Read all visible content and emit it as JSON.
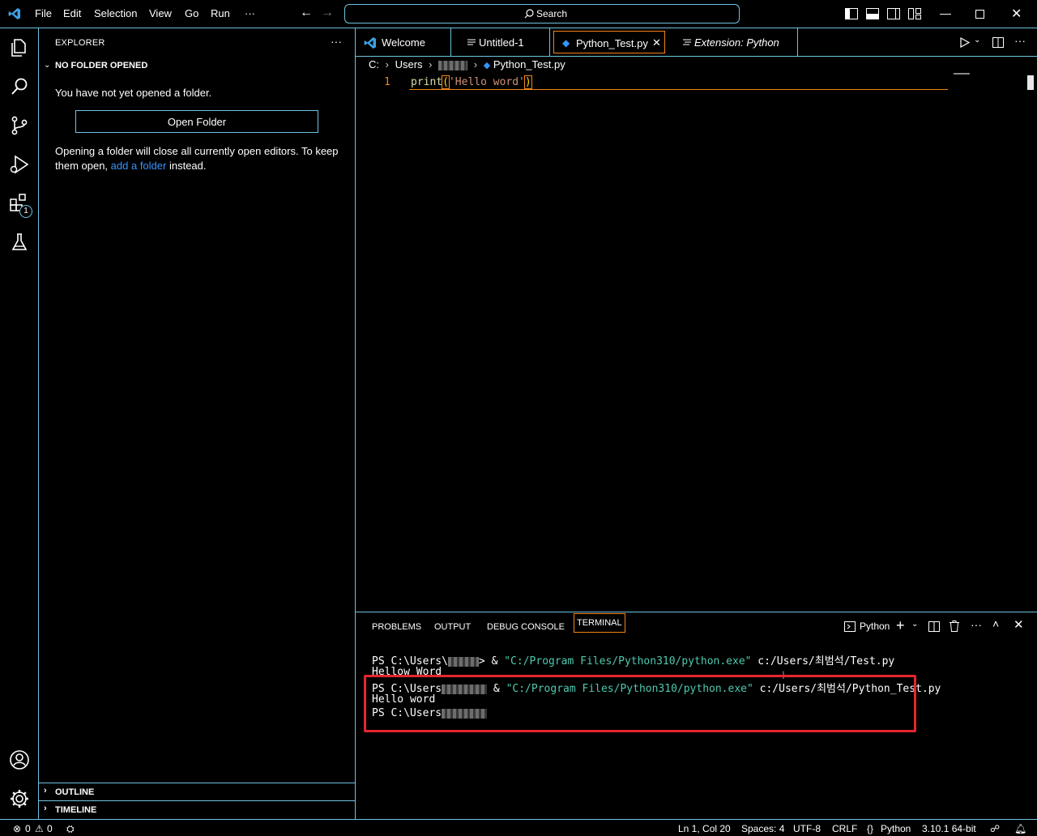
{
  "titlebar": {
    "menus": [
      "File",
      "Edit",
      "Selection",
      "View",
      "Go",
      "Run",
      "···"
    ],
    "search_label": "Search"
  },
  "sidebar": {
    "title": "EXPLORER",
    "section_title": "NO FOLDER OPENED",
    "message": "You have not yet opened a folder.",
    "open_folder_label": "Open Folder",
    "hint_prefix": "Opening a folder will close all currently open editors. To keep them open,",
    "hint_link": "add a folder",
    "hint_suffix": "instead.",
    "outline_label": "OUTLINE",
    "timeline_label": "TIMELINE",
    "extensions_badge": "1"
  },
  "tabs": [
    {
      "label": "Welcome"
    },
    {
      "label": "Untitled-1"
    },
    {
      "label": "Python_Test.py"
    },
    {
      "label": "Extension: Python"
    }
  ],
  "breadcrumb": {
    "drive": "C:",
    "folder": "Users",
    "file": "Python_Test.py"
  },
  "editor": {
    "line_number": "1",
    "code_fn": "print",
    "code_open": "(",
    "code_str": "'Hello word'",
    "code_close": ")"
  },
  "panel": {
    "tabs": [
      "PROBLEMS",
      "OUTPUT",
      "DEBUG CONSOLE",
      "TERMINAL"
    ],
    "shell_label": "Python",
    "terminal": {
      "l1_prefix": "PS C:\\Users\\",
      "l1_amp": "> & ",
      "l1_exe": "\"C:/Program Files/Python310/python.exe\"",
      "l1_path": " c:/Users/최범석/Test.py",
      "l2": "Hellow Word",
      "l3_prefix": "PS C:\\Users",
      "l3_amp": " & ",
      "l3_exe": "\"C:/Program Files/Python310/python.exe\"",
      "l3_path": " c:/Users/최범석/Python_Test.py",
      "l4": "Hello word",
      "l5_prefix": "PS C:\\Users"
    }
  },
  "statusbar": {
    "errors": "0",
    "warnings": "0",
    "position": "Ln 1, Col 20",
    "spaces": "Spaces: 4",
    "encoding": "UTF-8",
    "eol": "CRLF",
    "language": "Python",
    "interpreter": "3.10.1 64-bit"
  },
  "colors": {
    "contrast_border": "#6fc3df",
    "active_border": "#f38518",
    "highlight_red": "#e3262e",
    "link_blue": "#3794ff",
    "string_teal": "#4ec9b0"
  }
}
